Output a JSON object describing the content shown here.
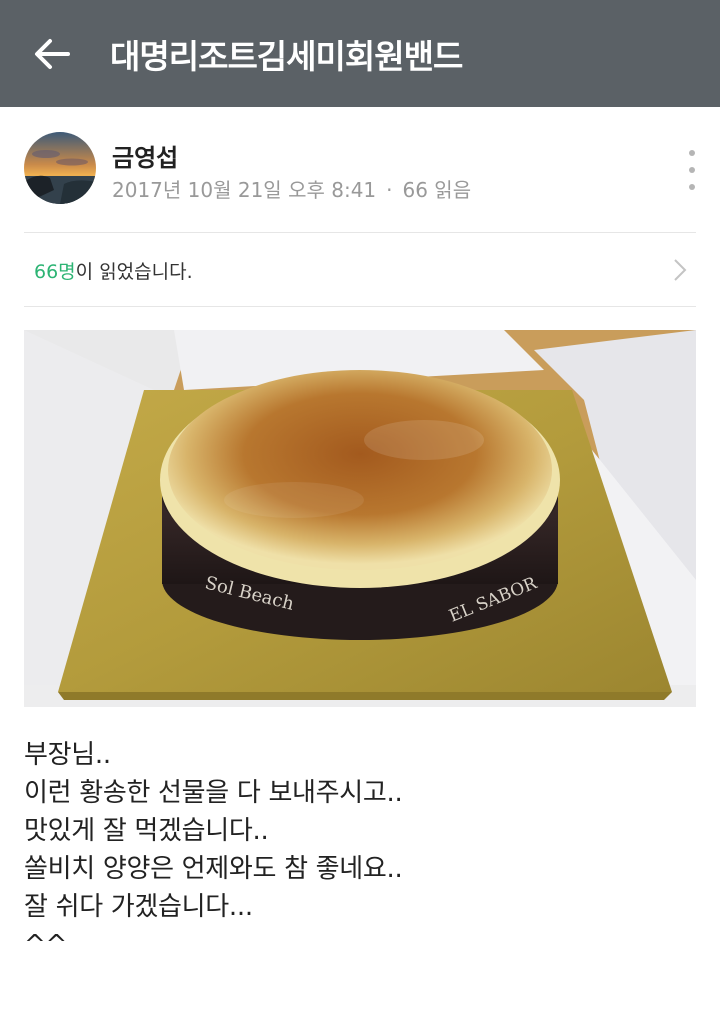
{
  "header": {
    "title": "대명리조트김세미회원밴드"
  },
  "post": {
    "author_name": "금영섭",
    "date": "2017년 10월 21일 오후 8:41",
    "dot": "·",
    "views": "66 읽음",
    "readers_count": "66명",
    "readers_suffix": "이 읽었습니다.",
    "photo_box_text_1": "Sol Beach",
    "photo_box_text_2": "EL SABOR",
    "body_lines": [
      "부장님..",
      "이런 황송한 선물을 다 보내주시고..",
      "맛있게 잘 먹겠습니다..",
      "쏠비치 양양은 언제와도 참 좋네요..",
      "잘 쉬다 가겠습니다...",
      "^^"
    ]
  },
  "colors": {
    "topbar": "#5b6166",
    "accent_green": "#2db474",
    "meta_gray": "#999999"
  },
  "icons": {
    "back": "arrow-left-icon",
    "more": "more-vertical-icon",
    "chevron": "chevron-right-icon"
  }
}
